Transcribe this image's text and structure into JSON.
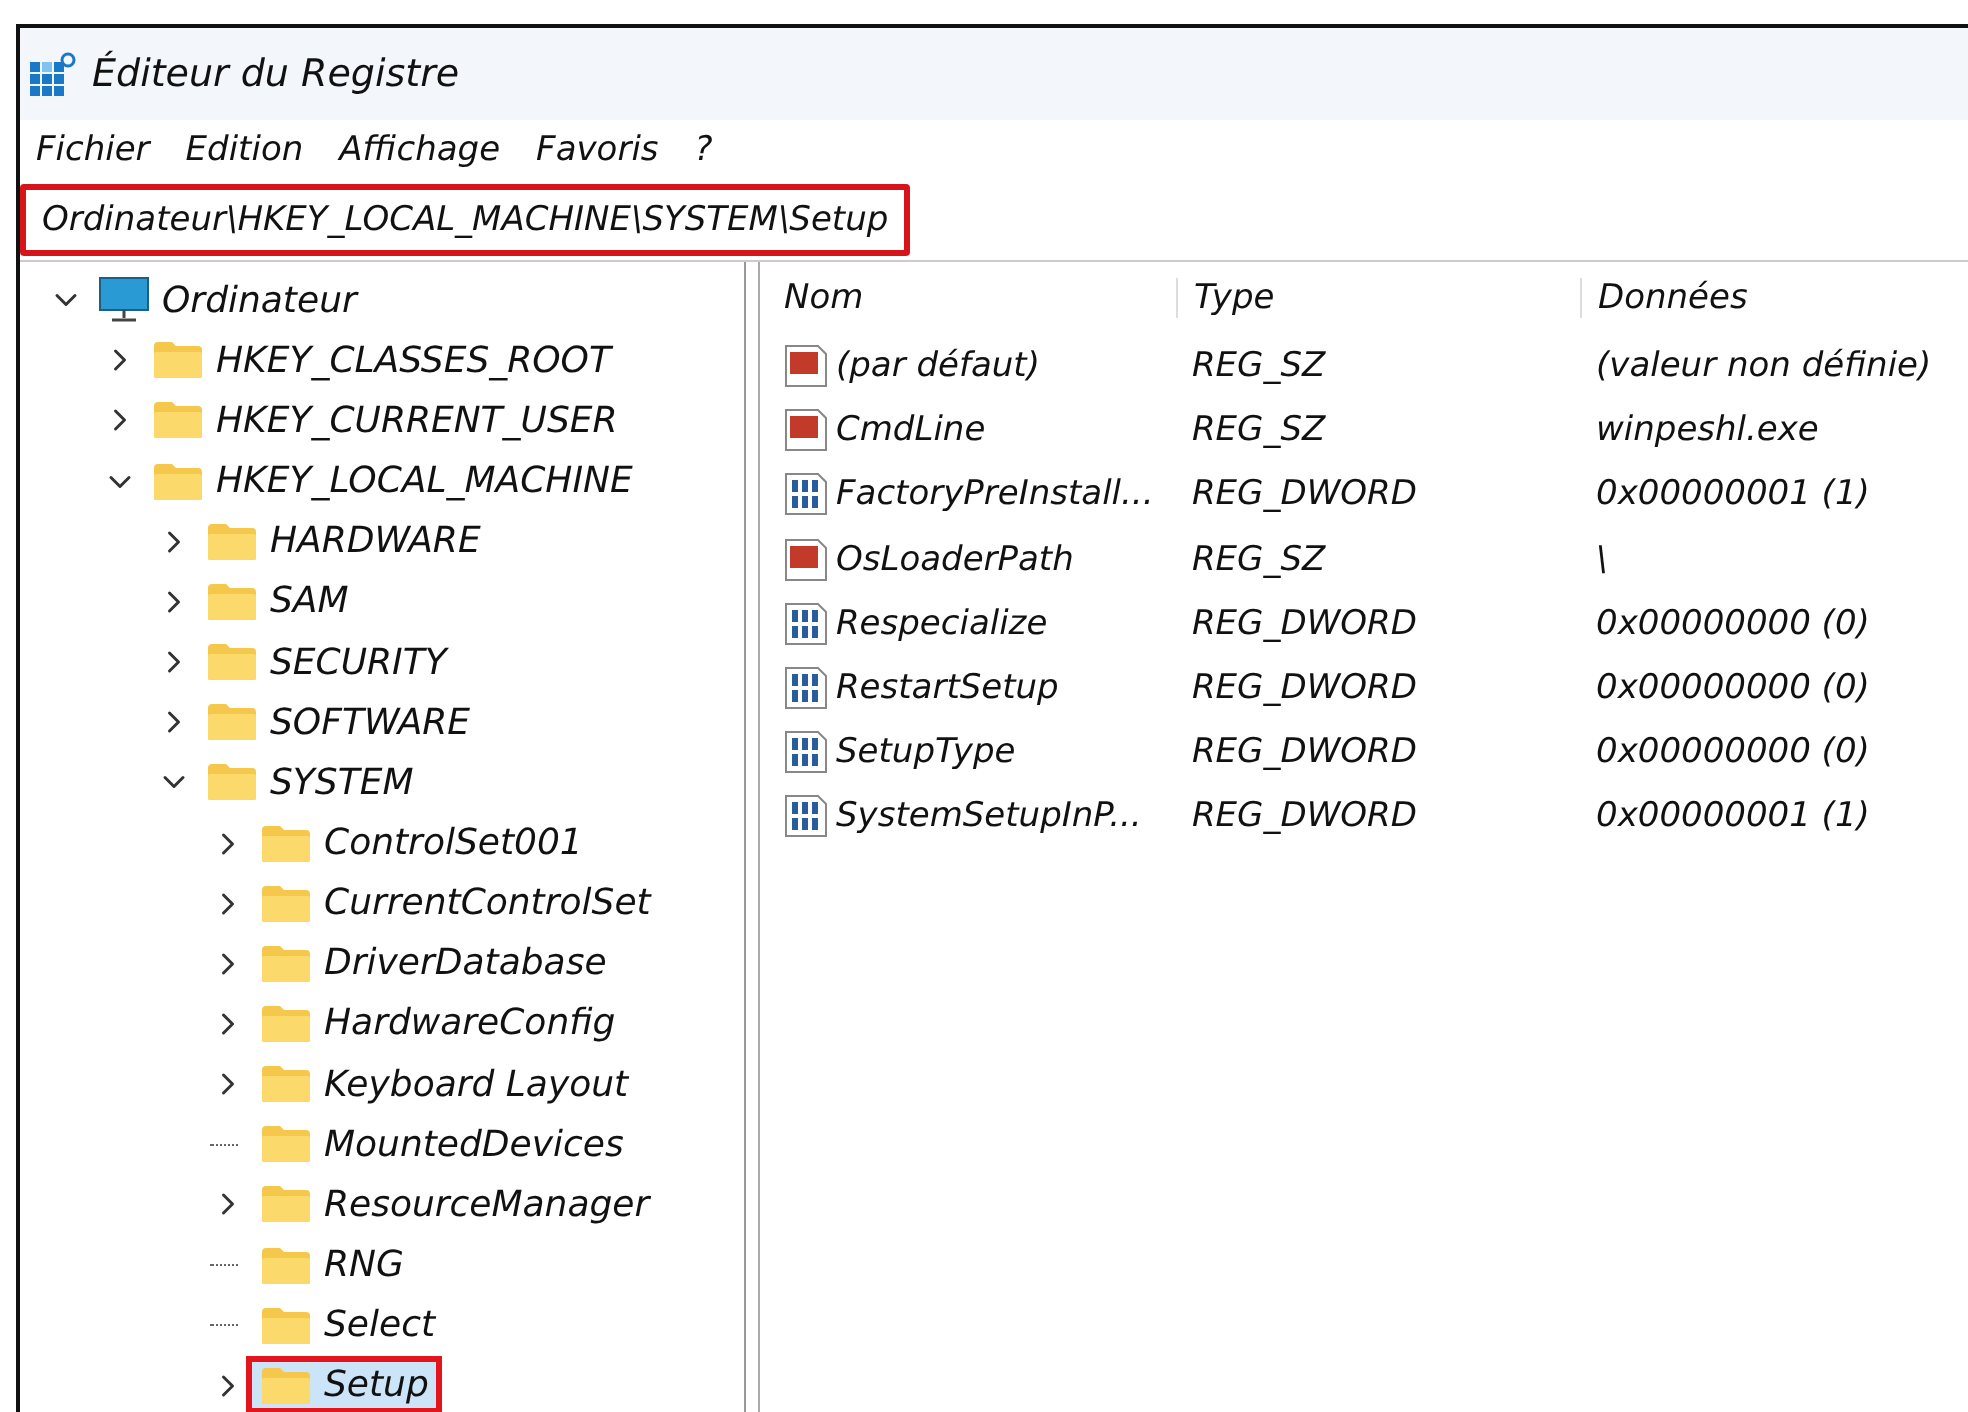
{
  "window": {
    "title": "Éditeur du Registre"
  },
  "menu": [
    {
      "label": "Fichier"
    },
    {
      "label": "Edition"
    },
    {
      "label": "Affichage"
    },
    {
      "label": "Favoris"
    },
    {
      "label": "?"
    }
  ],
  "address_bar": {
    "value": "Ordinateur\\HKEY_LOCAL_MACHINE\\SYSTEM\\Setup",
    "highlighted": true
  },
  "tree": [
    {
      "label": "Ordinateur",
      "kind": "computer",
      "expanded": true,
      "has_children": true,
      "selected": false,
      "highlighted": false,
      "children": [
        {
          "label": "HKEY_CLASSES_ROOT",
          "kind": "folder",
          "expanded": false,
          "has_children": true,
          "selected": false,
          "highlighted": false
        },
        {
          "label": "HKEY_CURRENT_USER",
          "kind": "folder",
          "expanded": false,
          "has_children": true,
          "selected": false,
          "highlighted": false
        },
        {
          "label": "HKEY_LOCAL_MACHINE",
          "kind": "folder",
          "expanded": true,
          "has_children": true,
          "selected": false,
          "highlighted": false,
          "children": [
            {
              "label": "HARDWARE",
              "kind": "folder",
              "expanded": false,
              "has_children": true,
              "selected": false,
              "highlighted": false
            },
            {
              "label": "SAM",
              "kind": "folder",
              "expanded": false,
              "has_children": true,
              "selected": false,
              "highlighted": false
            },
            {
              "label": "SECURITY",
              "kind": "folder",
              "expanded": false,
              "has_children": true,
              "selected": false,
              "highlighted": false
            },
            {
              "label": "SOFTWARE",
              "kind": "folder",
              "expanded": false,
              "has_children": true,
              "selected": false,
              "highlighted": false
            },
            {
              "label": "SYSTEM",
              "kind": "folder",
              "expanded": true,
              "has_children": true,
              "selected": false,
              "highlighted": false,
              "children": [
                {
                  "label": "ControlSet001",
                  "kind": "folder",
                  "expanded": false,
                  "has_children": true,
                  "selected": false,
                  "highlighted": false
                },
                {
                  "label": "CurrentControlSet",
                  "kind": "folder",
                  "expanded": false,
                  "has_children": true,
                  "selected": false,
                  "highlighted": false
                },
                {
                  "label": "DriverDatabase",
                  "kind": "folder",
                  "expanded": false,
                  "has_children": true,
                  "selected": false,
                  "highlighted": false
                },
                {
                  "label": "HardwareConfig",
                  "kind": "folder",
                  "expanded": false,
                  "has_children": true,
                  "selected": false,
                  "highlighted": false
                },
                {
                  "label": "Keyboard Layout",
                  "kind": "folder",
                  "expanded": false,
                  "has_children": true,
                  "selected": false,
                  "highlighted": false
                },
                {
                  "label": "MountedDevices",
                  "kind": "folder",
                  "has_children": false,
                  "selected": false,
                  "highlighted": false
                },
                {
                  "label": "ResourceManager",
                  "kind": "folder",
                  "expanded": false,
                  "has_children": true,
                  "selected": false,
                  "highlighted": false
                },
                {
                  "label": "RNG",
                  "kind": "folder",
                  "has_children": false,
                  "selected": false,
                  "highlighted": false
                },
                {
                  "label": "Select",
                  "kind": "folder",
                  "has_children": false,
                  "selected": false,
                  "highlighted": false
                },
                {
                  "label": "Setup",
                  "kind": "folder",
                  "expanded": false,
                  "has_children": true,
                  "selected": true,
                  "highlighted": true
                }
              ]
            }
          ]
        }
      ]
    }
  ],
  "table": {
    "columns": [
      "Nom",
      "Type",
      "Données"
    ],
    "rows": [
      {
        "kind": "string",
        "name": "(par défaut)",
        "type": "REG_SZ",
        "data": "(valeur non définie)"
      },
      {
        "kind": "string",
        "name": "CmdLine",
        "type": "REG_SZ",
        "data": "winpeshl.exe"
      },
      {
        "kind": "binary",
        "name": "FactoryPreInstall...",
        "type": "REG_DWORD",
        "data": "0x00000001 (1)"
      },
      {
        "kind": "string",
        "name": "OsLoaderPath",
        "type": "REG_SZ",
        "data": "\\"
      },
      {
        "kind": "binary",
        "name": "Respecialize",
        "type": "REG_DWORD",
        "data": "0x00000000 (0)"
      },
      {
        "kind": "binary",
        "name": "RestartSetup",
        "type": "REG_DWORD",
        "data": "0x00000000 (0)"
      },
      {
        "kind": "binary",
        "name": "SetupType",
        "type": "REG_DWORD",
        "data": "0x00000000 (0)"
      },
      {
        "kind": "binary",
        "name": "SystemSetupInP...",
        "type": "REG_DWORD",
        "data": "0x00000001 (1)"
      }
    ]
  }
}
